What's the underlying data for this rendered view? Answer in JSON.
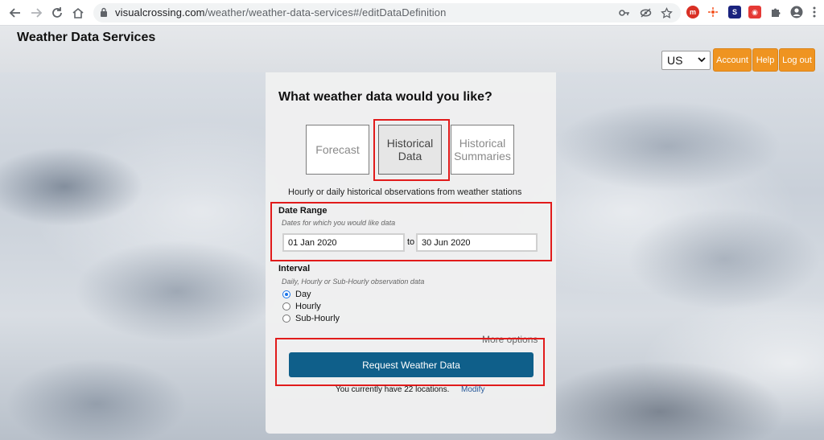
{
  "browser": {
    "url_host": "visualcrossing.com",
    "url_path": "/weather/weather-data-services#/editDataDefinition"
  },
  "header": {
    "site_title": "Weather Data Services",
    "unit_selected": "US",
    "account_label": "Account",
    "help_label": "Help",
    "logout_label": "Log out"
  },
  "panel": {
    "heading": "What weather data would you like?",
    "choices": {
      "forecast_line1": "Forecast",
      "historical_line1": "Historical",
      "historical_line2": "Data",
      "summaries_line1": "Historical",
      "summaries_line2": "Summaries"
    },
    "description": "Hourly or daily historical observations from weather stations",
    "date_range": {
      "label": "Date Range",
      "help": "Dates for which you would like data",
      "start": "01 Jan 2020",
      "to": "to",
      "end": "30 Jun 2020"
    },
    "interval": {
      "label": "Interval",
      "help": "Daily, Hourly or Sub-Hourly observation data",
      "options": [
        "Day",
        "Hourly",
        "Sub-Hourly"
      ],
      "selected": "Day"
    },
    "more_options": "More options",
    "request_button": "Request Weather Data",
    "locations_text": "You currently have 22 locations.",
    "modify_link": "Modify"
  },
  "colors": {
    "orange_button": "#ef9421",
    "request_button": "#0f5f8a",
    "highlight_red": "#e11b1b",
    "radio_selected": "#1a73e8"
  }
}
